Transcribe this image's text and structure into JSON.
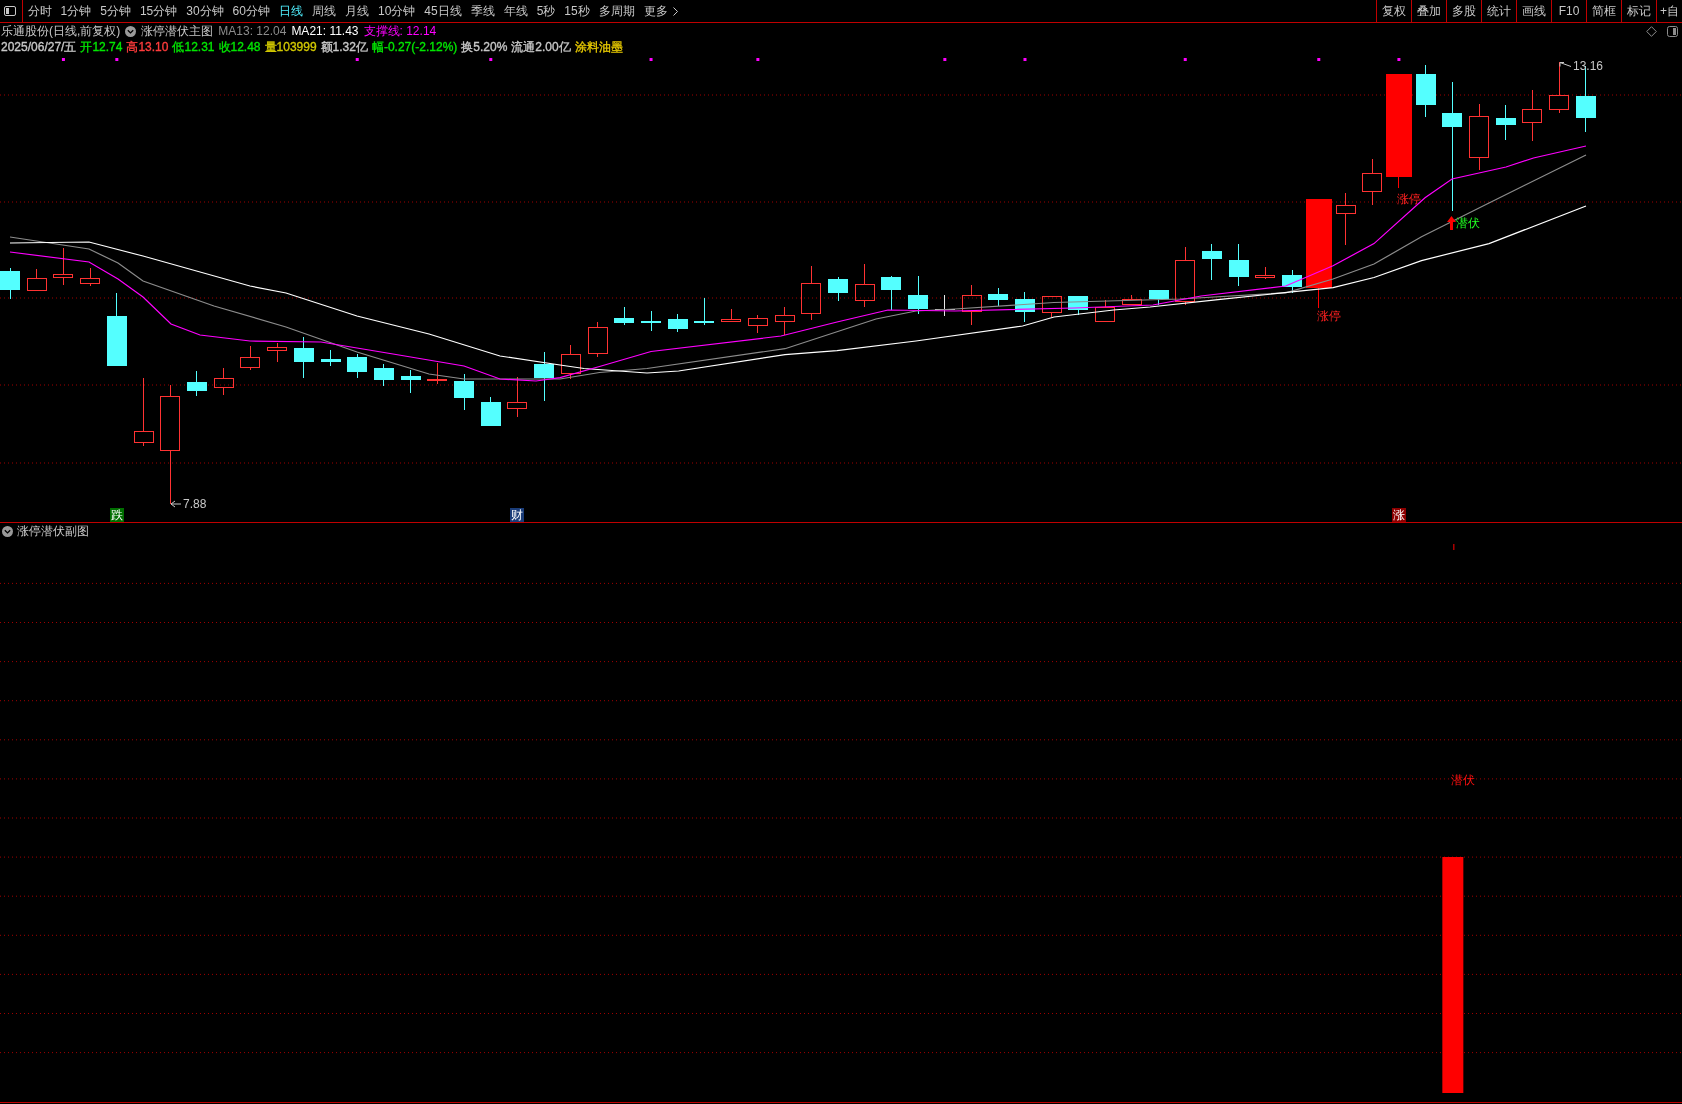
{
  "toolbar": {
    "periods": [
      {
        "label": "分时",
        "selected": false
      },
      {
        "label": "1分钟",
        "selected": false
      },
      {
        "label": "5分钟",
        "selected": false
      },
      {
        "label": "15分钟",
        "selected": false
      },
      {
        "label": "30分钟",
        "selected": false
      },
      {
        "label": "60分钟",
        "selected": false
      },
      {
        "label": "日线",
        "selected": true
      },
      {
        "label": "周线",
        "selected": false
      },
      {
        "label": "月线",
        "selected": false
      },
      {
        "label": "10分钟",
        "selected": false
      },
      {
        "label": "45日线",
        "selected": false
      },
      {
        "label": "季线",
        "selected": false
      },
      {
        "label": "年线",
        "selected": false
      },
      {
        "label": "5秒",
        "selected": false
      },
      {
        "label": "15秒",
        "selected": false
      },
      {
        "label": "多周期",
        "selected": false
      }
    ],
    "more": "更多",
    "buttons": [
      "复权",
      "叠加",
      "多股",
      "统计",
      "画线",
      "F10",
      "简框",
      "标记",
      "+自"
    ]
  },
  "header": {
    "title": "乐通股份(日线,前复权)",
    "indicator": "涨停潜伏主图",
    "lines": [
      {
        "text": "MA13: 12.04",
        "color": "#8c8c8c"
      },
      {
        "text": "MA21: 11.43",
        "color": "#ffffff"
      },
      {
        "text": "支撑线: 12.14",
        "color": "#ff00ff"
      }
    ],
    "quote": [
      {
        "text": "2025/06/27/五",
        "color": "#c8c8c8"
      },
      {
        "text": "开12.74",
        "color": "#00e600"
      },
      {
        "text": "高13.10",
        "color": "#ff3c3c"
      },
      {
        "text": "低12.31",
        "color": "#00e600"
      },
      {
        "text": "收12.48",
        "color": "#00e600"
      },
      {
        "text": "量103999",
        "color": "#d2c800"
      },
      {
        "text": "额1.32亿",
        "color": "#c8c8c8"
      },
      {
        "text": "幅-0.27(-2.12%)",
        "color": "#00e600"
      },
      {
        "text": "换5.20%",
        "color": "#c8c8c8"
      },
      {
        "text": "流通2.00亿",
        "color": "#c8c8c8"
      },
      {
        "text": "涂料油墨",
        "color": "#e6c800"
      }
    ]
  },
  "main_chart": {
    "low_label": "7.88",
    "high_label": "13.16",
    "signals": [
      {
        "kind": "limit_up",
        "text": "涨停"
      },
      {
        "kind": "limit_up",
        "text": "涨停"
      },
      {
        "kind": "ambush",
        "text": "潜伏"
      }
    ],
    "badges": [
      {
        "text": "跌",
        "color": "#006e00"
      },
      {
        "text": "财",
        "color": "#1a3c78"
      },
      {
        "text": "涨",
        "color": "#8c0000"
      }
    ]
  },
  "sub_chart": {
    "title": "涨停潜伏副图",
    "signal": "潜伏"
  }
}
